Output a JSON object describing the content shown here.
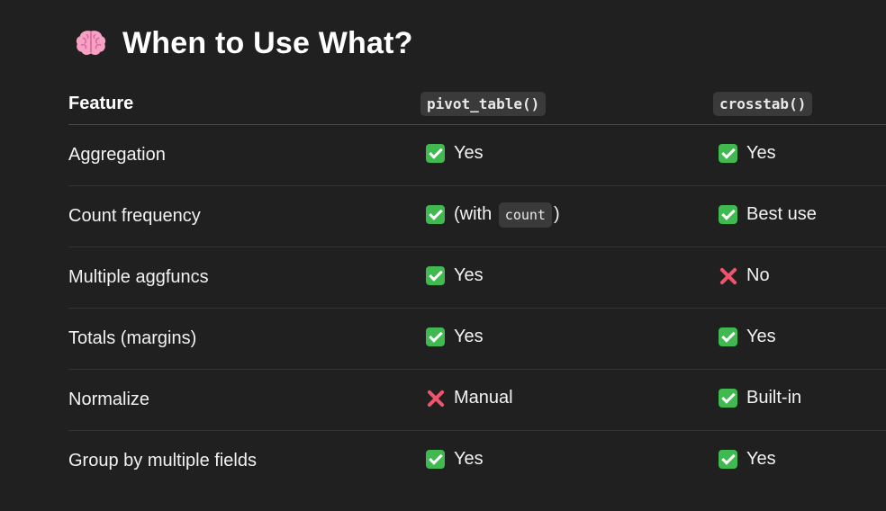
{
  "title": {
    "emoji": "brain-icon",
    "text": "When to Use What?"
  },
  "table": {
    "headers": {
      "feature": "Feature",
      "col1": "pivot_table()",
      "col2": "crosstab()"
    },
    "rows": [
      {
        "feature": "Aggregation",
        "pivot": {
          "icon": "check-icon",
          "text": "Yes"
        },
        "crosstab": {
          "icon": "check-icon",
          "text": "Yes"
        }
      },
      {
        "feature": "Count frequency",
        "pivot": {
          "icon": "check-icon",
          "text_before": "(with",
          "code": "count",
          "text_after": ")"
        },
        "crosstab": {
          "icon": "check-icon",
          "text": "Best use"
        }
      },
      {
        "feature": "Multiple aggfuncs",
        "pivot": {
          "icon": "check-icon",
          "text": "Yes"
        },
        "crosstab": {
          "icon": "cross-icon",
          "text": "No"
        }
      },
      {
        "feature": "Totals (margins)",
        "pivot": {
          "icon": "check-icon",
          "text": "Yes"
        },
        "crosstab": {
          "icon": "check-icon",
          "text": "Yes"
        }
      },
      {
        "feature": "Normalize",
        "pivot": {
          "icon": "cross-icon",
          "text": "Manual"
        },
        "crosstab": {
          "icon": "check-icon",
          "text": "Built-in"
        }
      },
      {
        "feature": "Group by multiple fields",
        "pivot": {
          "icon": "check-icon",
          "text": "Yes"
        },
        "crosstab": {
          "icon": "check-icon",
          "text": "Yes"
        }
      }
    ]
  },
  "colors": {
    "background": "#202020",
    "check": "#3fb950",
    "cross": "#f0546a",
    "code_bg": "#3a3a3a"
  }
}
